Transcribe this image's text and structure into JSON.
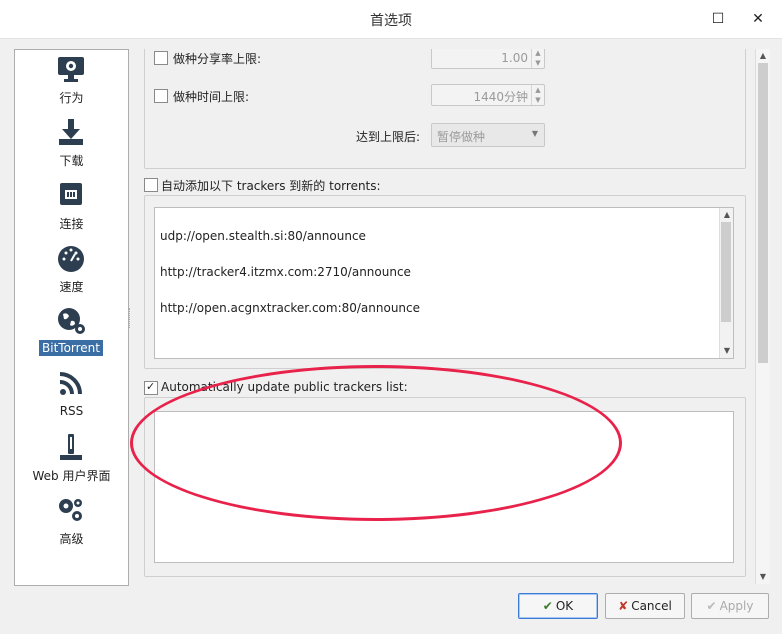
{
  "window": {
    "title": "首选项",
    "maximize_glyph": "☐",
    "close_glyph": "✕"
  },
  "sidebar": {
    "items": [
      {
        "label": "行为",
        "icon": "monitor-gear-icon"
      },
      {
        "label": "下载",
        "icon": "download-icon"
      },
      {
        "label": "连接",
        "icon": "network-icon"
      },
      {
        "label": "速度",
        "icon": "speedometer-icon"
      },
      {
        "label": "BitTorrent",
        "icon": "globe-gear-icon",
        "selected": true
      },
      {
        "label": "RSS",
        "icon": "rss-icon"
      },
      {
        "label": "Web 用户界面",
        "icon": "web-ui-icon"
      },
      {
        "label": "高级",
        "icon": "gears-icon"
      }
    ]
  },
  "seeding_limits": {
    "ratio_label": "做种分享率上限:",
    "ratio_value": "1.00",
    "time_label": "做种时间上限:",
    "time_value": "1440分钟",
    "action_label": "达到上限后:",
    "action_value": "暂停做种"
  },
  "trackers": {
    "auto_add_label": "自动添加以下 trackers 到新的 torrents:",
    "auto_add_checked": false,
    "list": [
      "udp://open.stealth.si:80/announce",
      "http://tracker4.itzmx.com:2710/announce",
      "http://open.acgnxtracker.com:80/announce"
    ],
    "auto_update_label": "Automatically update public trackers list:",
    "auto_update_checked": true,
    "auto_update_url": ""
  },
  "buttons": {
    "ok": "OK",
    "cancel": "Cancel",
    "apply": "Apply"
  },
  "colors": {
    "selection": "#3a6ea5",
    "annotation": "#e8224a"
  }
}
